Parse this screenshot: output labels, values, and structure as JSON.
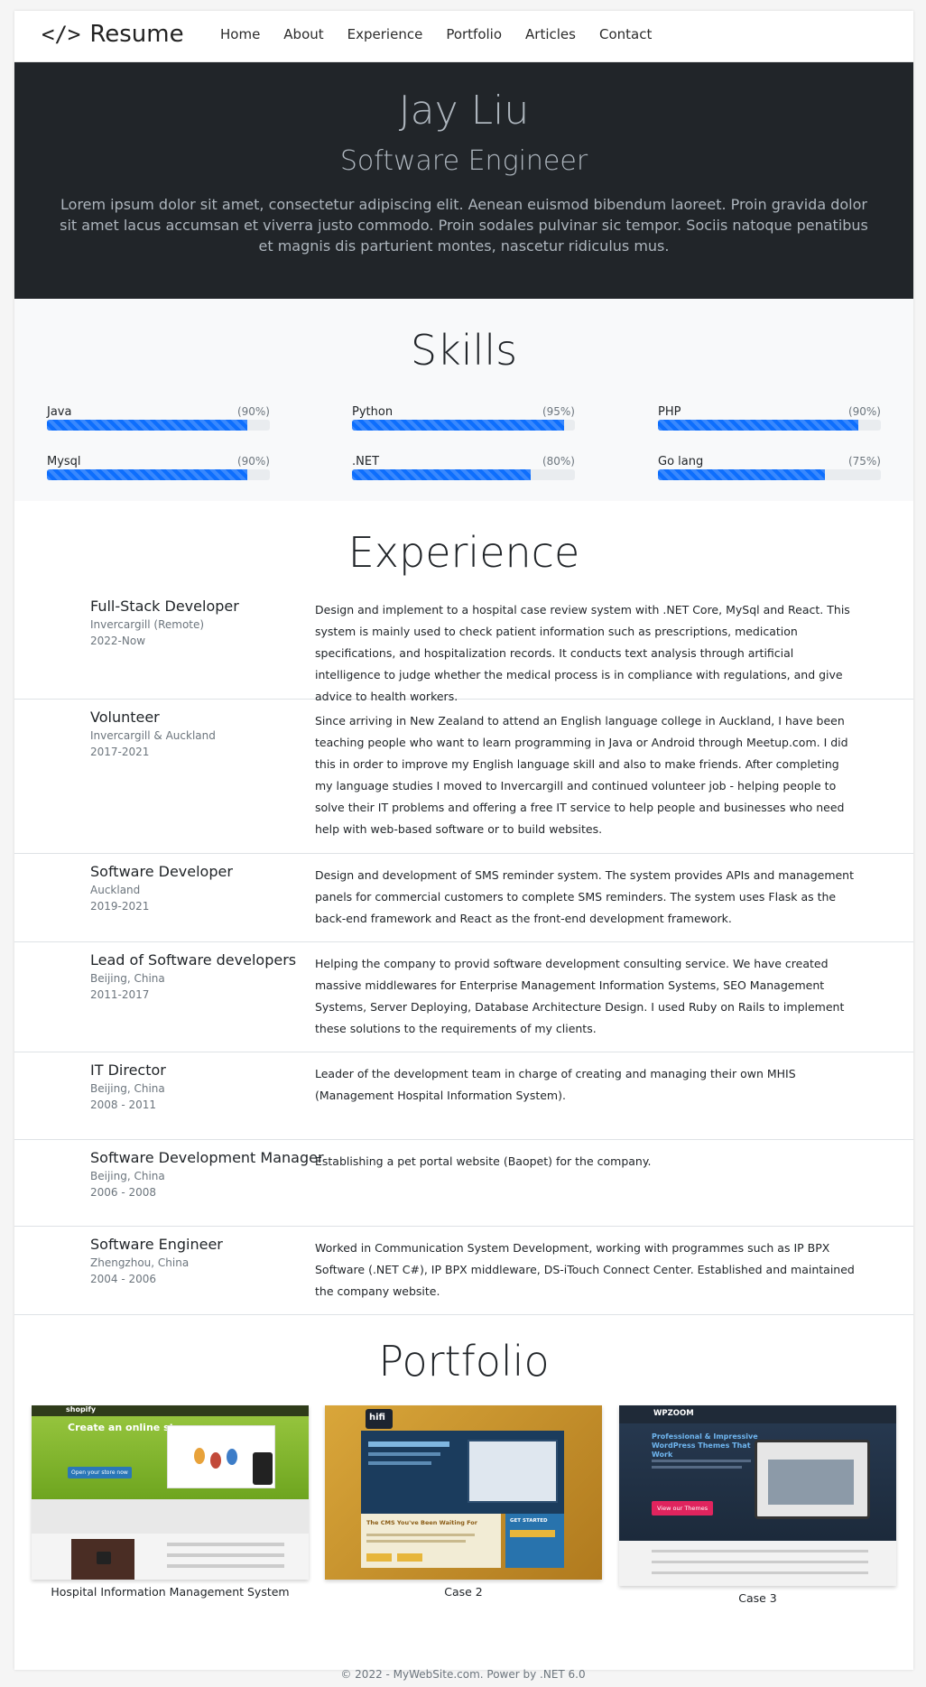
{
  "nav": {
    "brand_icon": "</>",
    "brand_text": "Resume",
    "items": [
      "Home",
      "About",
      "Experience",
      "Portfolio",
      "Articles",
      "Contact"
    ]
  },
  "hero": {
    "name": "Jay Liu",
    "role": "Software Engineer",
    "text": "Lorem ipsum dolor sit amet, consectetur adipiscing elit. Aenean euismod bibendum laoreet. Proin gravida dolor sit amet lacus accumsan et viverra justo commodo. Proin sodales pulvinar sic tempor. Sociis natoque penatibus et magnis dis parturient montes, nascetur ridiculus mus."
  },
  "skills": {
    "title": "Skills",
    "items": [
      {
        "name": "Java",
        "percent_label": "(90%)",
        "value": 90
      },
      {
        "name": "Python",
        "percent_label": "(95%)",
        "value": 95
      },
      {
        "name": "PHP",
        "percent_label": "(90%)",
        "value": 90
      },
      {
        "name": "Mysql",
        "percent_label": "(90%)",
        "value": 90
      },
      {
        "name": ".NET",
        "percent_label": "(80%)",
        "value": 80
      },
      {
        "name": "Go lang",
        "percent_label": "(75%)",
        "value": 75
      }
    ]
  },
  "experience": {
    "title": "Experience",
    "items": [
      {
        "role": "Full-Stack Developer",
        "place": "Invercargill (Remote)",
        "years": "2022-Now",
        "desc": "Design and implement to a hospital case review system with .NET Core, MySql and React. This system is mainly used to check patient information such as prescriptions, medication specifications, and hospitalization records. It conducts text analysis through artificial intelligence to judge whether the medical process is in compliance with regulations, and give advice to health workers."
      },
      {
        "role": "Volunteer",
        "place": "Invercargill & Auckland",
        "years": "2017-2021",
        "desc": "Since arriving in New Zealand to attend an English language college in Auckland, I have been teaching people who want to learn programming in Java or Android through Meetup.com. I did this in order to improve my English language skill and also to make friends. After completing my language studies I moved to Invercargill and continued volunteer job - helping people to solve their IT problems and offering a free IT service to help people and businesses who need help with web-based software or to build websites."
      },
      {
        "role": "Software Developer",
        "place": "Auckland",
        "years": "2019-2021",
        "desc": "Design and development of SMS reminder system. The system provides APIs and management panels for commercial customers to complete SMS reminders. The system uses Flask as the back-end framework and React as the front-end development framework."
      },
      {
        "role": "Lead of Software developers",
        "place": "Beijing, China",
        "years": "2011-2017",
        "desc": "Helping the company to provid software development consulting service. We have created massive middlewares for Enterprise Management Information Systems, SEO Management Systems, Server Deploying, Database Architecture Design. I used Ruby on Rails to implement these solutions to the requirements of my clients."
      },
      {
        "role": "IT Director",
        "place": "Beijing, China",
        "years": "2008 - 2011",
        "desc": "Leader of the development team in charge of creating and managing their own MHIS (Management Hospital Information System)."
      },
      {
        "role": "Software Development Manager",
        "place": "Beijing, China",
        "years": "2006 - 2008",
        "desc": "Establishing a pet portal website (Baopet) for the company."
      },
      {
        "role": "Software Engineer",
        "place": "Zhengzhou, China",
        "years": "2004 - 2006",
        "desc": "Worked in Communication System Development, working with programmes such as IP BPX Software (.NET C#), IP BPX middleware, DS-iTouch Connect Center. Established and maintained the company website."
      }
    ]
  },
  "portfolio": {
    "title": "Portfolio",
    "items": [
      {
        "caption": "Hospital Information Management System",
        "thumb_brand": "shopify",
        "thumb_headline": "Create an online store",
        "thumb_button": "Open your store now"
      },
      {
        "caption": "Case 2",
        "thumb_brand": "hifi",
        "thumb_headline": "The CMS You've Been Waiting For",
        "thumb_button": "GET STARTED"
      },
      {
        "caption": "Case 3",
        "thumb_brand": "WPZOOM",
        "thumb_headline": "Professional & Impressive WordPress Themes That Work",
        "thumb_button": "View our Themes"
      }
    ]
  },
  "footer": {
    "text": "© 2022 - MyWebSite.com. Power by .NET 6.0"
  },
  "colors": {
    "hero_bg": "#212529",
    "accent": "#0d6efd",
    "skills_bg": "#f8f9fa"
  }
}
